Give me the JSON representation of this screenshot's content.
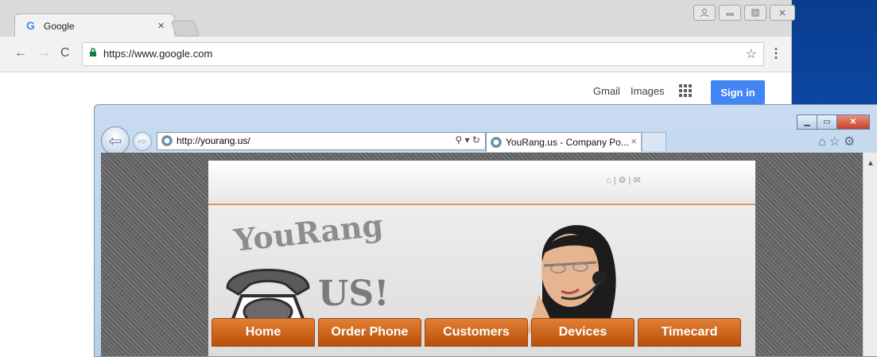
{
  "chrome": {
    "tab_title": "Google",
    "tab_close": "×",
    "url": "https://www.google.com",
    "google_bar": {
      "gmail": "Gmail",
      "images": "Images",
      "signin": "Sign in"
    }
  },
  "ie": {
    "url_prefix": "http://",
    "url_host": "yourang.us",
    "url_suffix": "/",
    "tab_title": "YouRang.us - Company Po...",
    "tab_close": "×"
  },
  "site": {
    "logo_line1": "YouRang",
    "logo_line2": "US!",
    "header_icons": "⌂ | ⚙ | ✉",
    "nav": [
      "Home",
      "Order Phone",
      "Customers",
      "Devices",
      "Timecard"
    ]
  },
  "colors": {
    "google_blue": "#4285f4",
    "nav_orange": "#d36c24",
    "ie_frame": "#c8dbf0"
  }
}
